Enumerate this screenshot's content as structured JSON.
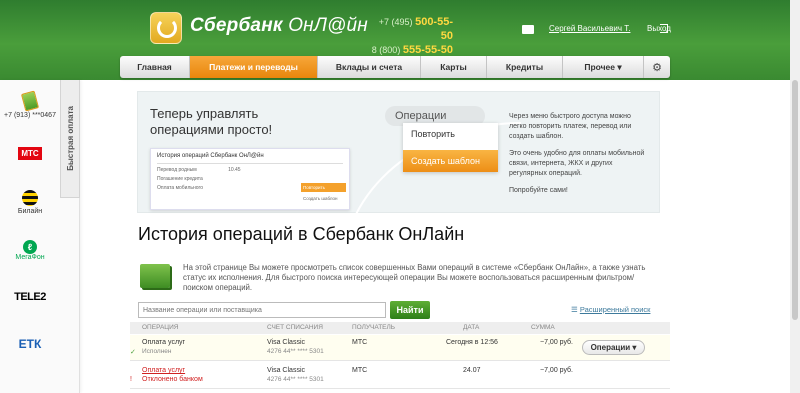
{
  "header": {
    "brand": "Сбербанк",
    "brand_suffix": "ОнЛ@йн",
    "phone1_prefix": "+7 (495)",
    "phone1_number": "500-55-50",
    "phone2_prefix": "8 (800)",
    "phone2_number": "555-55-50",
    "user_name": "Сергей Васильевич Т.",
    "logout": "Выход"
  },
  "nav": {
    "items": [
      {
        "label": "Главная"
      },
      {
        "label": "Платежи и переводы"
      },
      {
        "label": "Вклады и счета"
      },
      {
        "label": "Карты"
      },
      {
        "label": "Кредиты"
      },
      {
        "label": "Прочее ▾"
      }
    ]
  },
  "quick_pay": {
    "tab_label": "Быстрая оплата",
    "phone": "+7 (913) ***0467",
    "providers": [
      "МТС",
      "Билайн",
      "МегаФон",
      "TELE2",
      "ЕТК"
    ]
  },
  "banner": {
    "title": "Теперь управлять операциями просто!",
    "ops_label": "Операции",
    "menu_repeat": "Повторить",
    "menu_template": "Создать шаблон",
    "mini_title": "История операций Сбербанк ОнЛ@йн",
    "mini_row1": "Перевод родным",
    "mini_row1_val": "10.45",
    "mini_row2": "Погашение кредита",
    "mini_row3": "Оплата мобильного",
    "mini_repeat": "Повторить",
    "mini_template": "Создать шаблон",
    "text1": "Через меню быстрого доступа можно легко повторить платеж, перевод или создать шаблон.",
    "text2": "Это очень удобно для оплаты мобильной связи, интернета, ЖКХ и других регулярных операций.",
    "text3": "Попробуйте сами!"
  },
  "page": {
    "title": "История операций в Сбербанк ОнЛайн",
    "description": "На этой странице Вы можете просмотреть список совершенных Вами операций в системе «Сбербанк ОнЛайн», а также узнать статус их исполнения. Для быстрого поиска интересующей операции Вы можете воспользоваться расширенным фильтром/поиском операций."
  },
  "search": {
    "placeholder": "Название операции или поставщика",
    "button": "Найти",
    "advanced": "Расширенный поиск"
  },
  "table": {
    "headers": [
      "ОПЕРАЦИЯ",
      "СЧЕТ СПИСАНИЯ",
      "ПОЛУЧАТЕЛЬ",
      "ДАТА",
      "СУММА"
    ],
    "rows": [
      {
        "operation": "Оплата услуг",
        "status": "Исполнен",
        "account": "Visa Classic",
        "account_num": "4276 44** **** 5301",
        "recipient": "МТС",
        "date": "Сегодня в 12:56",
        "amount": "−7,00 руб.",
        "action": "Операции ▾"
      },
      {
        "operation": "Оплата услуг",
        "status": "Отклонено банком",
        "account": "Visa Classic",
        "account_num": "4276 44** **** 5301",
        "recipient": "МТС",
        "date": "24.07",
        "amount": "−7,00 руб."
      }
    ]
  }
}
